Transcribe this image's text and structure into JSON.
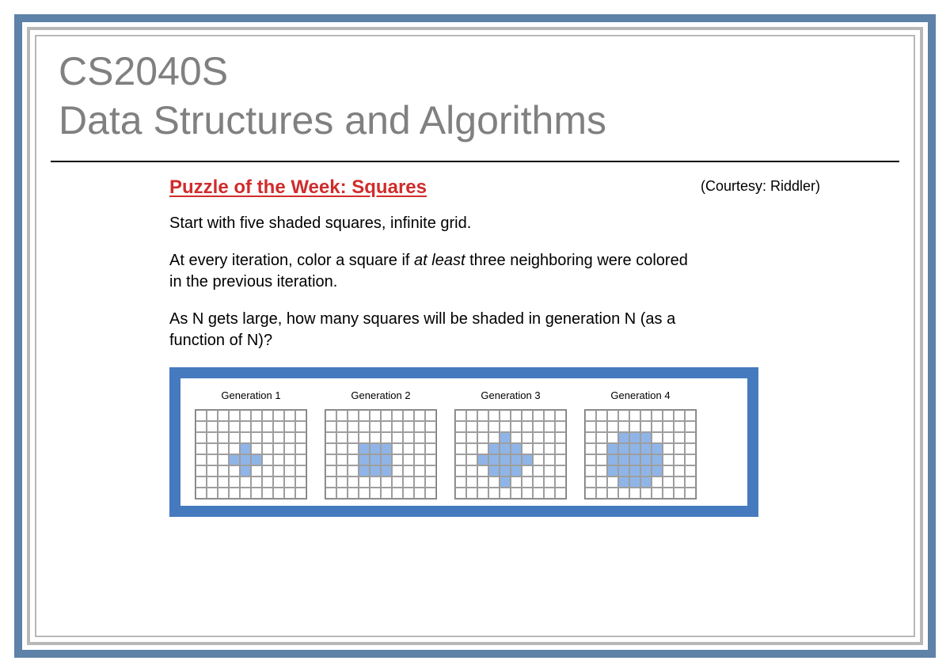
{
  "header": {
    "course_code": "CS2040S",
    "course_title": "Data Structures and Algorithms"
  },
  "puzzle": {
    "title": "Puzzle of the Week: Squares",
    "courtesy": "(Courtesy: Riddler)",
    "line1": "Start with five shaded squares, infinite grid.",
    "line2a": "At every iteration, color a square if ",
    "line2_em": "at least",
    "line2b": " three neighboring were colored in the previous iteration.",
    "line3": "As N gets large, how many squares will be shaded in generation N (as a function of N)?"
  },
  "generations": [
    {
      "label": "Generation 1",
      "shaded": [
        [
          3,
          4
        ],
        [
          4,
          3
        ],
        [
          4,
          4
        ],
        [
          4,
          5
        ],
        [
          5,
          4
        ]
      ]
    },
    {
      "label": "Generation 2",
      "shaded": [
        [
          3,
          3
        ],
        [
          3,
          4
        ],
        [
          3,
          5
        ],
        [
          4,
          3
        ],
        [
          4,
          4
        ],
        [
          4,
          5
        ],
        [
          5,
          3
        ],
        [
          5,
          4
        ],
        [
          5,
          5
        ]
      ]
    },
    {
      "label": "Generation 3",
      "shaded": [
        [
          2,
          4
        ],
        [
          3,
          3
        ],
        [
          3,
          4
        ],
        [
          3,
          5
        ],
        [
          4,
          2
        ],
        [
          4,
          3
        ],
        [
          4,
          4
        ],
        [
          4,
          5
        ],
        [
          4,
          6
        ],
        [
          5,
          3
        ],
        [
          5,
          4
        ],
        [
          5,
          5
        ],
        [
          6,
          4
        ]
      ]
    },
    {
      "label": "Generation 4",
      "shaded": [
        [
          2,
          3
        ],
        [
          2,
          4
        ],
        [
          2,
          5
        ],
        [
          3,
          2
        ],
        [
          3,
          3
        ],
        [
          3,
          4
        ],
        [
          3,
          5
        ],
        [
          3,
          6
        ],
        [
          4,
          2
        ],
        [
          4,
          3
        ],
        [
          4,
          4
        ],
        [
          4,
          5
        ],
        [
          4,
          6
        ],
        [
          5,
          2
        ],
        [
          5,
          3
        ],
        [
          5,
          4
        ],
        [
          5,
          5
        ],
        [
          5,
          6
        ],
        [
          6,
          3
        ],
        [
          6,
          4
        ],
        [
          6,
          5
        ]
      ]
    }
  ]
}
